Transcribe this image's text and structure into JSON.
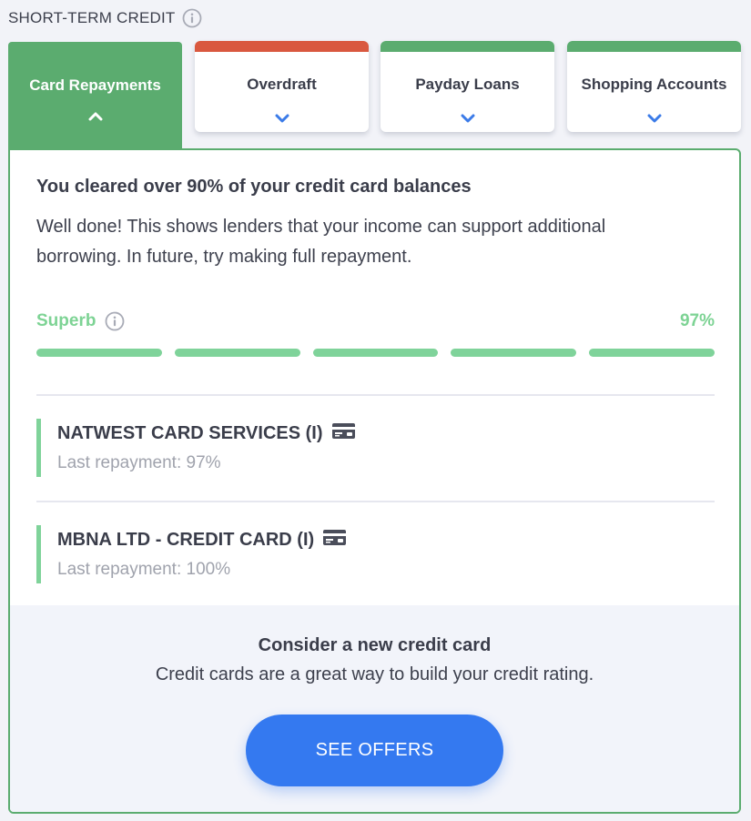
{
  "section": {
    "title": "SHORT-TERM CREDIT",
    "info_icon": "info-icon"
  },
  "tabs": [
    {
      "label": "Card Repayments",
      "active": true,
      "icon": "chevron-up-icon",
      "color": "#5bac6f"
    },
    {
      "label": "Overdraft",
      "active": false,
      "icon": "chevron-down-icon",
      "color": "#d9583f"
    },
    {
      "label": "Payday Loans",
      "active": false,
      "icon": "chevron-down-icon",
      "color": "#5bac6f"
    },
    {
      "label": "Shopping Accounts",
      "active": false,
      "icon": "chevron-down-icon",
      "color": "#5bac6f"
    }
  ],
  "panel": {
    "headline": "You cleared over 90% of your credit card balances",
    "description": "Well done! This shows lenders that your income can support additional borrowing. In future, try making full repayment.",
    "rating": {
      "label": "Superb",
      "value": "97%",
      "segments_filled": 5,
      "segments_total": 5,
      "color": "#7dd394"
    },
    "accounts": [
      {
        "name": "NATWEST CARD SERVICES (I)",
        "last_repayment": "Last repayment: 97%",
        "icon": "credit-card-icon"
      },
      {
        "name": "MBNA LTD - CREDIT CARD (I)",
        "last_repayment": "Last repayment: 100%",
        "icon": "credit-card-icon"
      }
    ]
  },
  "offer": {
    "title": "Consider a new credit card",
    "text": "Credit cards are a great way to build your credit rating.",
    "button_label": "SEE OFFERS",
    "button_color": "#3479f0"
  }
}
